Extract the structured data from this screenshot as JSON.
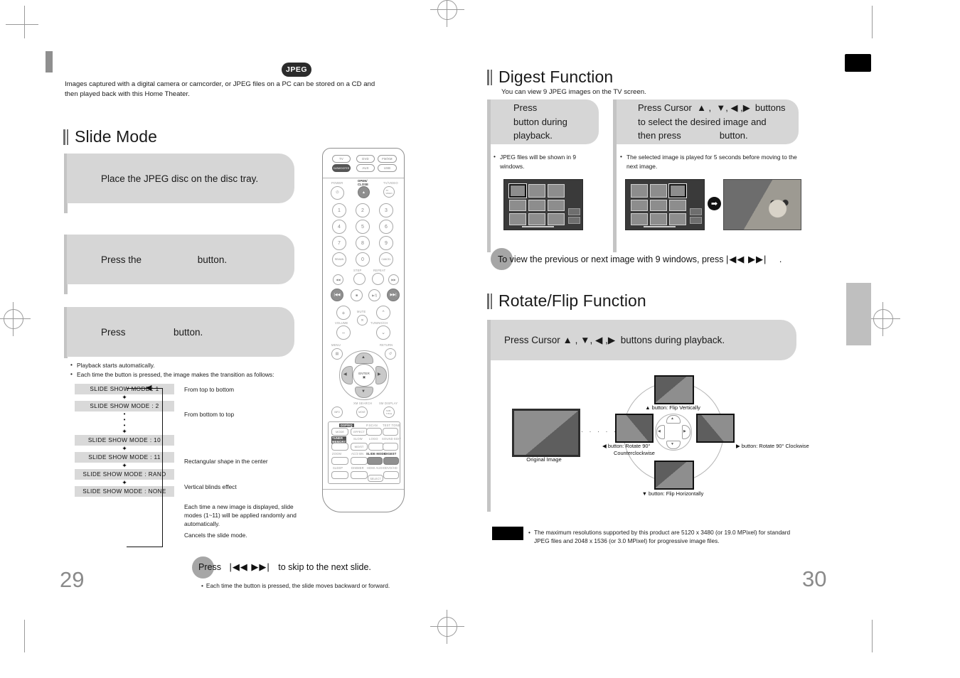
{
  "meta": {
    "left_page_number": "29",
    "right_page_number": "30"
  },
  "left": {
    "badge": "JPEG",
    "intro": "Images captured with a digital camera or camcorder, or JPEG files on a PC can be stored on a CD and then played back with this Home Theater.",
    "heading": "Slide Mode",
    "steps": [
      {
        "text": "Place the JPEG disc on the disc tray."
      },
      {
        "text": "Press the                     button."
      },
      {
        "text": "Press                  button."
      }
    ],
    "bullets": [
      "Playback starts automatically.",
      "Each time the button is pressed, the image makes the transition as follows:"
    ],
    "flow": {
      "chips": [
        "SLIDE SHOW MODE : 1",
        "SLIDE SHOW MODE : 2",
        "SLIDE SHOW MODE : 10",
        "SLIDE SHOW MODE : 11",
        "SLIDE SHOW MODE : RAND",
        "SLIDE SHOW MODE : NONE"
      ],
      "descriptions": [
        "From top to bottom",
        "From bottom to top",
        "Rectangular shape in the center",
        "Vertical blinds effect",
        "Each time a new image is displayed, slide modes (1~11) will be applied randomly and automatically.",
        "Cancels the slide mode."
      ]
    },
    "callout": {
      "circle_word": "Press",
      "text": "Press",
      "icons": "|◀◀  ▶▶|",
      "tail": "to skip to the next slide.",
      "note": "Each time the button is pressed, the slide moves backward or forward."
    }
  },
  "remote": {
    "source_buttons": [
      "TV",
      "DVD",
      "FM/XM",
      "SUBWOOFER",
      "AUX",
      "USB"
    ],
    "labels": {
      "power": "POWER",
      "open_close": "OPEN/\nCLOSE",
      "tv_video": "TV/VIDEO",
      "step": "STEP",
      "repeat": "REPEAT",
      "mute": "MUTE",
      "volume": "VOLUME",
      "tuning_ch": "TUNING/CH",
      "menu": "MENU",
      "return": "RETURN",
      "enter": "ENTER",
      "info": "INFO",
      "xm_search": "XM SEARCH",
      "move": "MOVE",
      "sm_display": "SM DISPLAY",
      "subtitle": "SUB TITLE"
    },
    "numeric_keys": [
      "1",
      "2",
      "3",
      "4",
      "5",
      "6",
      "7",
      "8",
      "9",
      "0"
    ],
    "special_keys": [
      "REMAIN",
      "CANCEL"
    ],
    "bottom_keys": [
      "P.SCAN",
      "TEST TONE",
      "MODE",
      "EFFECT",
      "TUNER MEMORY",
      "SLOW",
      "LOGO",
      "SOUND EDIT",
      "ZOOM",
      "AC/3 BN",
      "SLIDE MODE",
      "DIGEST",
      "SLEEP",
      "DIMMER",
      "HDMI AUDIO",
      "DVD/HD",
      "SELECT"
    ],
    "highlighted_keys": [
      "SLIDE MODE",
      "DIGEST"
    ]
  },
  "right": {
    "digest": {
      "heading": "Digest Function",
      "subtitle": "You can view 9 JPEG images on the TV screen.",
      "step1": "Press\nbutton during\nplayback.",
      "step2_lines": [
        "Press Cursor  ▲ ,  ▼, ◀ ,▶  buttons",
        "to select the desired image and",
        "then press               button."
      ],
      "note1": "JPEG files will be shown in 9 windows.",
      "note2": "The selected image is played for 5 seconds before moving to the next image."
    },
    "callout": {
      "text": "To view the previous or next image with 9 windows, press",
      "icons": "|◀◀ ▶▶|",
      "tail": "."
    },
    "rotate": {
      "heading": "Rotate/Flip Function",
      "step": "Press Cursor ▲ , ▼, ◀ ,▶  buttons during playback.",
      "original_caption": "Original Image",
      "captions": {
        "up": "▲ button: Flip Vertically",
        "left_line1": "◀ button: Rotate 90°",
        "left_line2": "Counterclockwise",
        "right": "▶ button: Rotate 90° Clockwise",
        "down": "▼ button: Flip Horizontally"
      }
    },
    "note": "The maximum resolutions supported by this product are 5120 x 3480 (or 19.0 MPixel) for standard JPEG files and 2048 x 1536 (or 3.0 MPixel) for progressive image files."
  }
}
